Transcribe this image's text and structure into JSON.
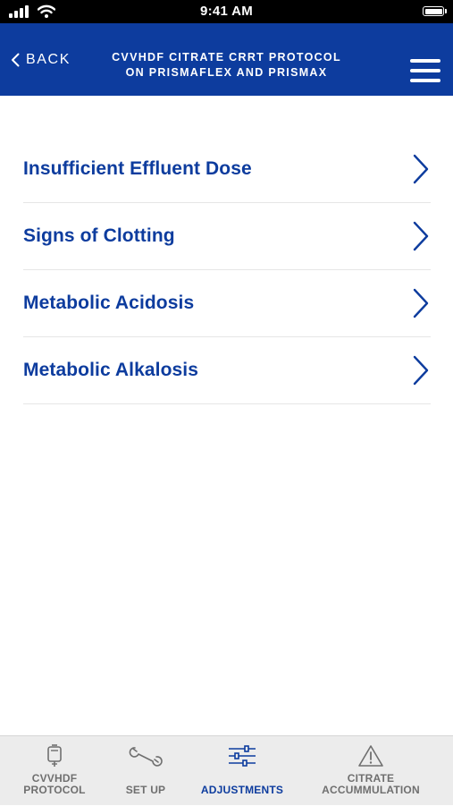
{
  "status_bar": {
    "time": "9:41 AM"
  },
  "header": {
    "back_label": "BACK",
    "title_line1": "CVVHDF CITRATE CRRT PROTOCOL",
    "title_line2": "ON PRISMAFLEX AND PRISMAX",
    "menu_icon": "hamburger-menu-icon",
    "background": "#0d3c9e"
  },
  "list": {
    "items": [
      {
        "label": "Insufficient Effluent Dose"
      },
      {
        "label": "Signs of Clotting"
      },
      {
        "label": "Metabolic Acidosis"
      },
      {
        "label": "Metabolic Alkalosis"
      }
    ],
    "text_color": "#0d3c9e",
    "chevron_icon": "chevron-right-icon"
  },
  "tab_bar": {
    "tabs": [
      {
        "line1": "CVVHDF",
        "line2": "PROTOCOL",
        "icon": "iv-bag-icon",
        "active": false
      },
      {
        "line1": "SET UP",
        "line2": "",
        "icon": "wrench-icon",
        "active": false
      },
      {
        "line1": "ADJUSTMENTS",
        "line2": "",
        "icon": "sliders-icon",
        "active": true
      },
      {
        "line1": "CITRATE",
        "line2": "ACCUMMULATION",
        "icon": "warning-icon",
        "active": false
      }
    ],
    "active_color": "#0d3c9e",
    "inactive_color": "#6f6f6f"
  }
}
